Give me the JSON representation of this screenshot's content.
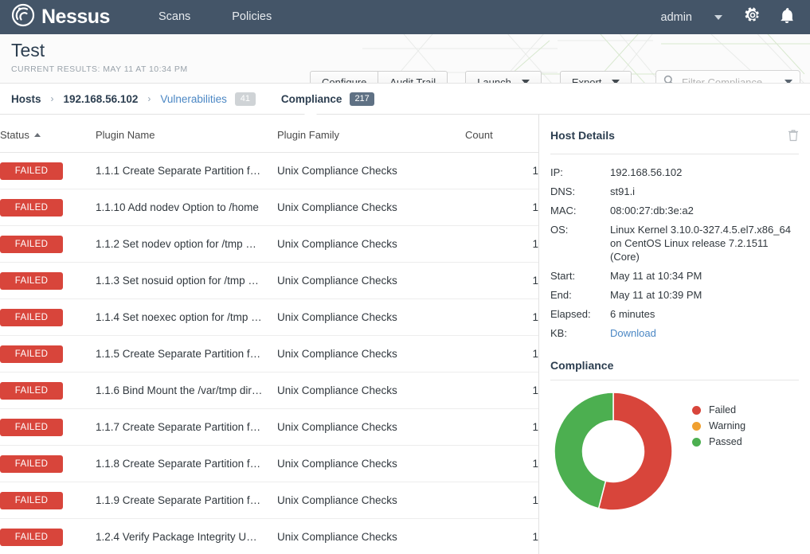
{
  "navbar": {
    "brand": "Nessus",
    "links": [
      {
        "label": "Scans"
      },
      {
        "label": "Policies"
      }
    ],
    "user": "admin",
    "icons": [
      "user-caret-icon",
      "gear-icon",
      "bell-icon"
    ],
    "bg_color": "#445568"
  },
  "titlebar": {
    "scan_name": "Test",
    "current_results": "CURRENT RESULTS: MAY 11 AT 10:34 PM",
    "buttons": {
      "configure": "Configure",
      "audit_trail": "Audit Trail",
      "launch": "Launch",
      "export": "Export"
    },
    "filter": {
      "placeholder": "Filter Compliance",
      "value": ""
    }
  },
  "breadcrumb": {
    "items": [
      {
        "label": "Hosts",
        "type": "crumb"
      },
      {
        "label": "192.168.56.102",
        "type": "crumb"
      },
      {
        "label": "Vulnerabilities",
        "type": "link",
        "badge": "41"
      }
    ],
    "separator": "›",
    "active_tab": {
      "label": "Compliance",
      "badge": "217"
    }
  },
  "table": {
    "columns": [
      "Status",
      "Plugin Name",
      "Plugin Family",
      "Count"
    ],
    "sort_column": "Status",
    "sort_direction": "asc",
    "rows": [
      {
        "status": "FAILED",
        "name": "1.1.1 Create Separate Partition f…",
        "family": "Unix Compliance Checks",
        "count": "1"
      },
      {
        "status": "FAILED",
        "name": "1.1.10 Add nodev Option to /home",
        "family": "Unix Compliance Checks",
        "count": "1"
      },
      {
        "status": "FAILED",
        "name": "1.1.2 Set nodev option for /tmp …",
        "family": "Unix Compliance Checks",
        "count": "1"
      },
      {
        "status": "FAILED",
        "name": "1.1.3 Set nosuid option for /tmp …",
        "family": "Unix Compliance Checks",
        "count": "1"
      },
      {
        "status": "FAILED",
        "name": "1.1.4 Set noexec option for /tmp …",
        "family": "Unix Compliance Checks",
        "count": "1"
      },
      {
        "status": "FAILED",
        "name": "1.1.5 Create Separate Partition f…",
        "family": "Unix Compliance Checks",
        "count": "1"
      },
      {
        "status": "FAILED",
        "name": "1.1.6 Bind Mount the /var/tmp dir…",
        "family": "Unix Compliance Checks",
        "count": "1"
      },
      {
        "status": "FAILED",
        "name": "1.1.7 Create Separate Partition f…",
        "family": "Unix Compliance Checks",
        "count": "1"
      },
      {
        "status": "FAILED",
        "name": "1.1.8 Create Separate Partition f…",
        "family": "Unix Compliance Checks",
        "count": "1"
      },
      {
        "status": "FAILED",
        "name": "1.1.9 Create Separate Partition f…",
        "family": "Unix Compliance Checks",
        "count": "1"
      },
      {
        "status": "FAILED",
        "name": "1.2.4 Verify Package Integrity U…",
        "family": "Unix Compliance Checks",
        "count": "1"
      }
    ],
    "status_color": "#d8453b"
  },
  "host_details": {
    "title": "Host Details",
    "delete_icon": "trash-icon",
    "rows": [
      {
        "key": "IP:",
        "value": "192.168.56.102"
      },
      {
        "key": "DNS:",
        "value": "st91.i"
      },
      {
        "key": "MAC:",
        "value": "08:00:27:db:3e:a2"
      },
      {
        "key": "OS:",
        "value": "Linux Kernel 3.10.0-327.4.5.el7.x86_64 on CentOS Linux release 7.2.1511 (Core)"
      },
      {
        "key": "Start:",
        "value": "May 11 at 10:34 PM"
      },
      {
        "key": "End:",
        "value": "May 11 at 10:39 PM"
      },
      {
        "key": "Elapsed:",
        "value": "6 minutes"
      },
      {
        "key": "KB:",
        "value": "Download",
        "link": true
      }
    ]
  },
  "compliance": {
    "title": "Compliance"
  },
  "chart_data": {
    "type": "pie",
    "title": "Compliance",
    "variant": "donut",
    "legend_position": "right",
    "categories": [
      "Failed",
      "Warning",
      "Passed"
    ],
    "values": [
      54,
      0,
      46
    ],
    "colors": [
      "#d8453b",
      "#f0a030",
      "#4caf50"
    ],
    "labels": [
      "Failed",
      "Warning",
      "Passed"
    ],
    "start_angle": 0,
    "inner_radius_ratio": 0.52
  }
}
